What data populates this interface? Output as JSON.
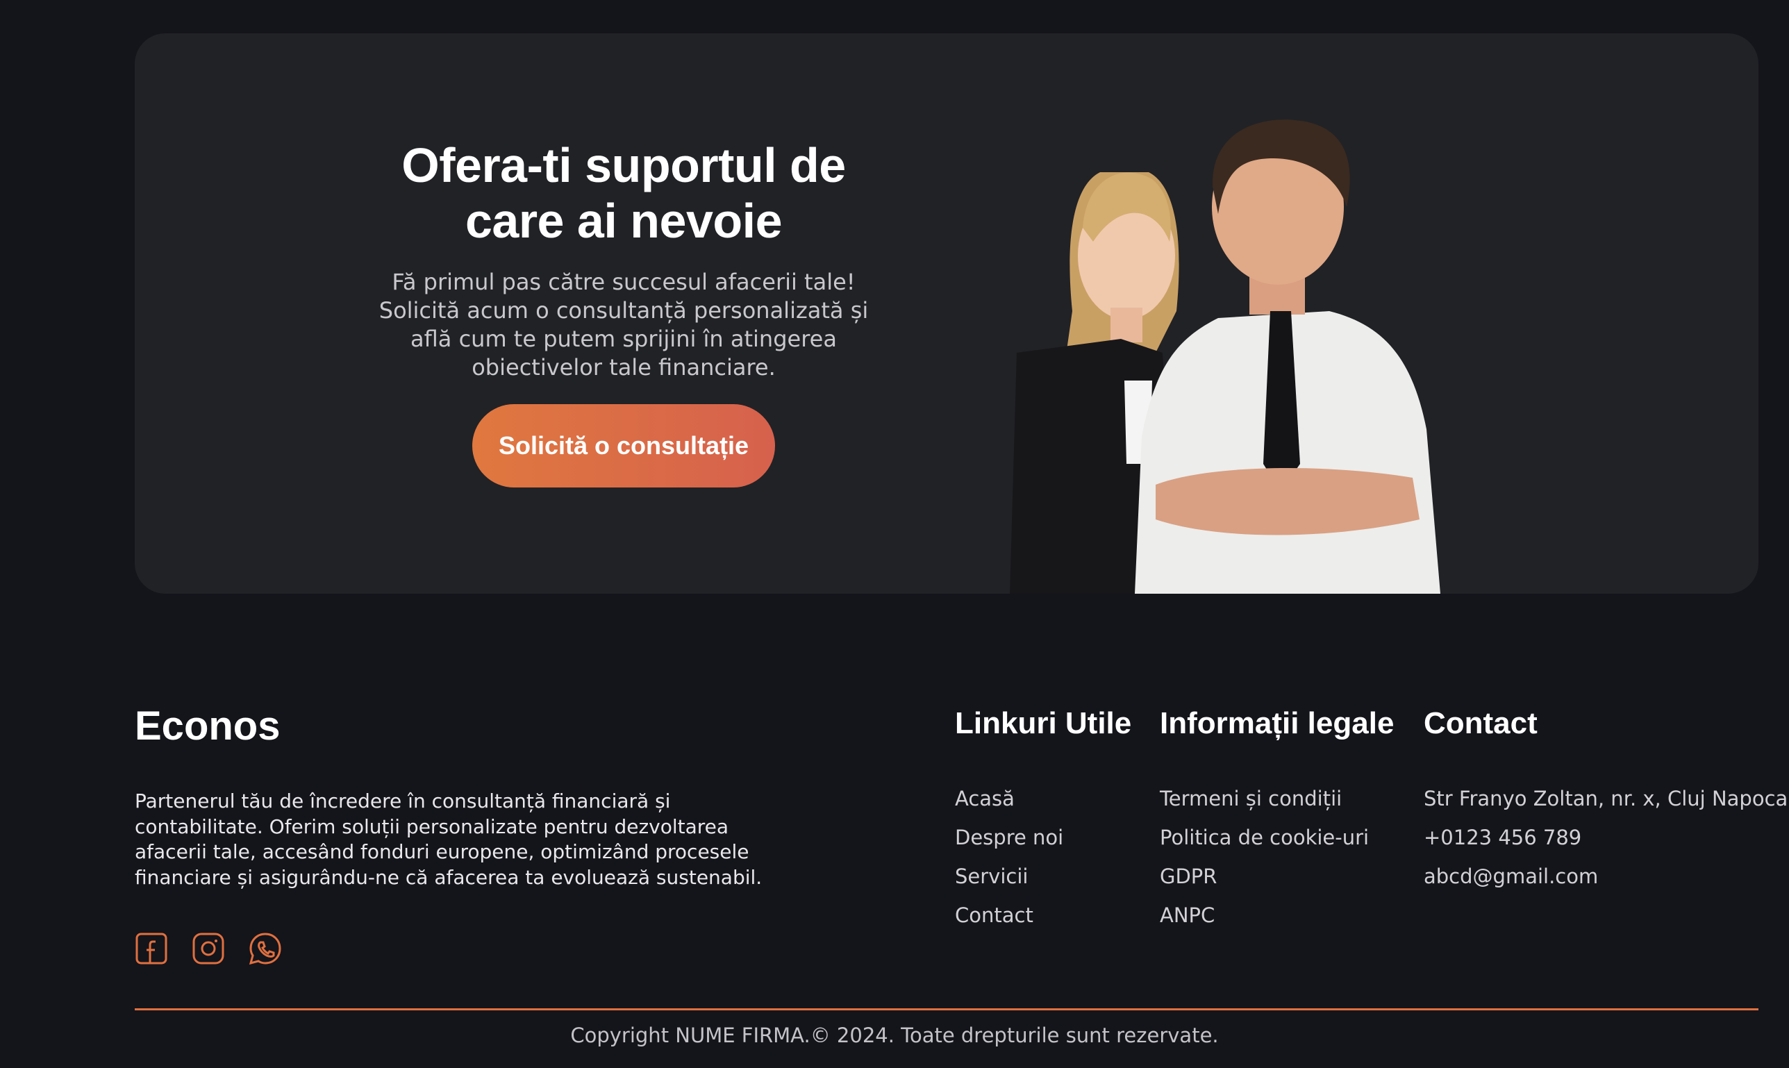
{
  "cta": {
    "title_line1": "Ofera-ti suportul de",
    "title_line2": "care ai nevoie",
    "description": "Fă primul pas către succesul afacerii tale! Solicită acum o consultanță personalizată și află cum te putem sprijini în atingerea obiectivelor tale financiare.",
    "button_label": "Solicită o consultație"
  },
  "footer": {
    "brand": "Econos",
    "brand_description": "Partenerul tău de încredere în consultanță financiară și contabilitate. Oferim soluții personalizate pentru dezvoltarea afacerii tale, accesând fonduri europene, optimizând procesele financiare și asigurându-ne că afacerea ta evoluează sustenabil.",
    "socials": [
      "facebook-icon",
      "instagram-icon",
      "whatsapp-icon"
    ],
    "columns": {
      "links": {
        "title": "Linkuri Utile",
        "items": [
          "Acasă",
          "Despre noi",
          "Servicii",
          "Contact"
        ]
      },
      "legal": {
        "title": "Informații legale",
        "items": [
          "Termeni și condiții",
          "Politica de cookie-uri",
          "GDPR",
          "ANPC"
        ]
      },
      "contact": {
        "title": "Contact",
        "items": [
          "Str Franyo Zoltan, nr. x, Cluj Napoca",
          "+0123 456 789",
          "abcd@gmail.com"
        ]
      }
    },
    "copyright": "Copyright NUME FIRMA.© 2024. Toate drepturile sunt rezervate."
  },
  "colors": {
    "background": "#14141b",
    "card": "#212226",
    "accent": "#e0703f",
    "accent_end": "#d6614d"
  }
}
